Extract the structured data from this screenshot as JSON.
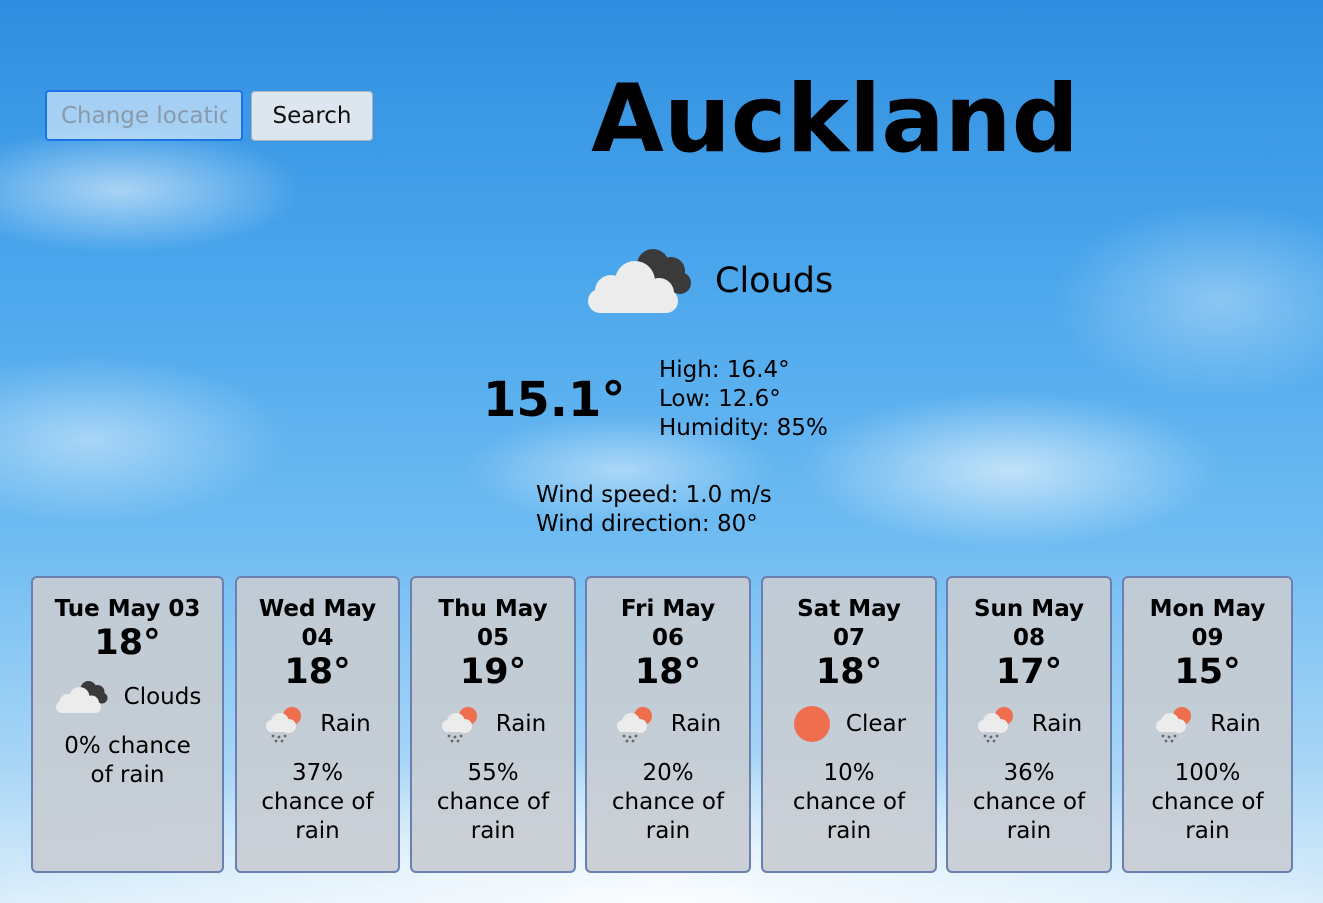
{
  "search": {
    "placeholder": "Change location",
    "button_label": "Search"
  },
  "location": {
    "city": "Auckland"
  },
  "current": {
    "condition": "Clouds",
    "condition_icon": "clouds-icon",
    "temperature": "15.1°",
    "high": "High: 16.4°",
    "low": "Low: 12.6°",
    "humidity": "Humidity: 85%",
    "wind_speed": "Wind speed: 1.0 m/s",
    "wind_direction": "Wind direction: 80°"
  },
  "colors": {
    "sun": "#ee6e4e",
    "cloud_dark": "#3a3a3a",
    "cloud_light": "#e8e8e8",
    "card_border": "#6b80b0"
  },
  "forecast": [
    {
      "day": "Tue May 03",
      "temp": "18°",
      "condition": "Clouds",
      "icon": "clouds-icon",
      "chance": "0% chance of rain"
    },
    {
      "day": "Wed May 04",
      "temp": "18°",
      "condition": "Rain",
      "icon": "rain-icon",
      "chance": "37% chance of rain"
    },
    {
      "day": "Thu May 05",
      "temp": "19°",
      "condition": "Rain",
      "icon": "rain-icon",
      "chance": "55% chance of rain"
    },
    {
      "day": "Fri May 06",
      "temp": "18°",
      "condition": "Rain",
      "icon": "rain-icon",
      "chance": "20% chance of rain"
    },
    {
      "day": "Sat May 07",
      "temp": "18°",
      "condition": "Clear",
      "icon": "sun-icon",
      "chance": "10% chance of rain"
    },
    {
      "day": "Sun May 08",
      "temp": "17°",
      "condition": "Rain",
      "icon": "rain-icon",
      "chance": "36% chance of rain"
    },
    {
      "day": "Mon May 09",
      "temp": "15°",
      "condition": "Rain",
      "icon": "rain-icon",
      "chance": "100% chance of rain"
    }
  ]
}
